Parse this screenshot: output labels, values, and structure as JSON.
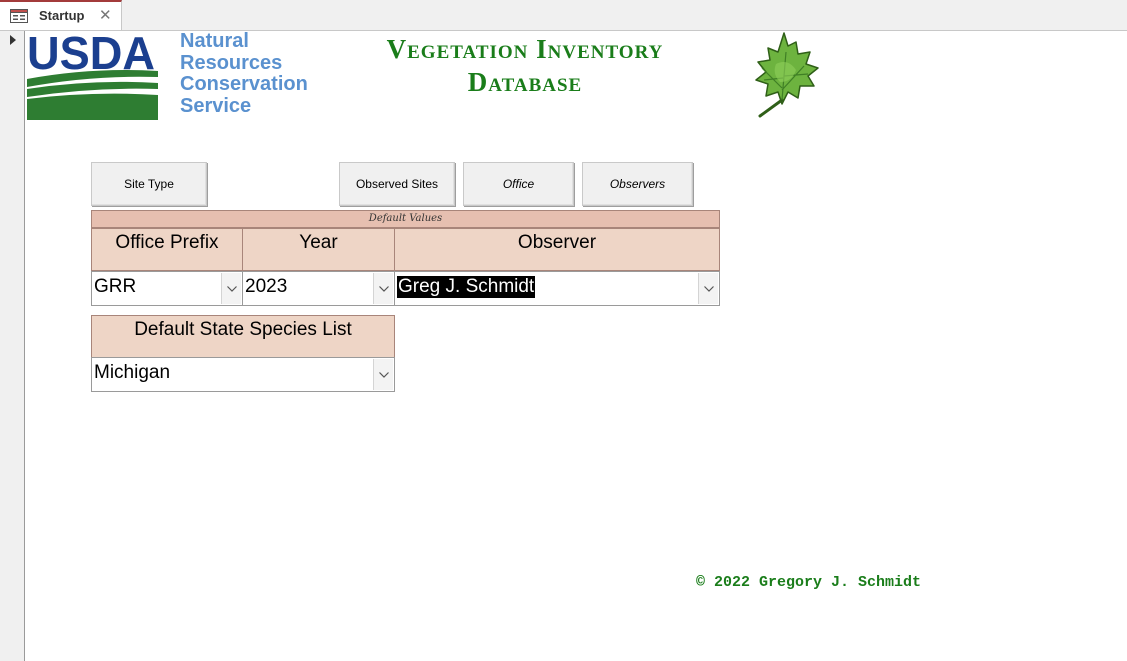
{
  "tab": {
    "title": "Startup",
    "close_glyph": "✕",
    "icon": "form-icon"
  },
  "logo": {
    "usda_text": "USDA",
    "agency_lines": [
      "Natural",
      "Resources",
      "Conservation",
      "Service"
    ]
  },
  "title": {
    "line1": "Vegetation Inventory",
    "line2": "Database"
  },
  "buttons": {
    "site_type": "Site Type",
    "observed_sites": "Observed Sites",
    "office": "Office",
    "observers": "Observers"
  },
  "defaults": {
    "band_label": "Default Values",
    "office_prefix": {
      "label": "Office Prefix",
      "value": "GRR"
    },
    "year": {
      "label": "Year",
      "value": "2023"
    },
    "observer": {
      "label": "Observer",
      "value": "Greg J. Schmidt"
    }
  },
  "state_list": {
    "label": "Default State Species List",
    "value": "Michigan"
  },
  "copyright": "© 2022 Gregory J. Schmidt",
  "colors": {
    "title_green": "#1a7d1a",
    "agency_blue": "#5a91cf",
    "usda_navy": "#1b3f8f",
    "header_band": "#e6bfb0",
    "column_header": "#eed5c6"
  }
}
